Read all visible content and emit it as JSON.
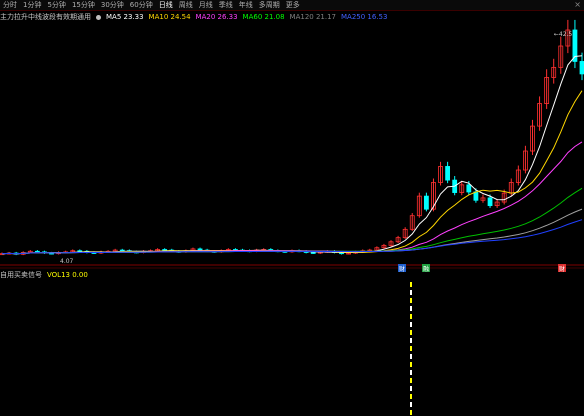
{
  "toolbar": {
    "tabs": [
      "分时",
      "1分钟",
      "5分钟",
      "15分钟",
      "30分钟",
      "60分钟",
      "日线",
      "周线",
      "月线",
      "季线",
      "年线",
      "多周期",
      "更多"
    ],
    "active": 6,
    "close_glyph": "×"
  },
  "main_indicator": {
    "formula_name": "主力拉升中线波段有效期通用",
    "items": [
      {
        "label": "MA5",
        "value": "23.33",
        "color": "#ffffff"
      },
      {
        "label": "MA10",
        "value": "24.54",
        "color": "#ffd700"
      },
      {
        "label": "MA20",
        "value": "26.33",
        "color": "#ff40ff"
      },
      {
        "label": "MA60",
        "value": "21.08",
        "color": "#00ff00"
      },
      {
        "label": "MA120",
        "value": "21.17",
        "color": "#808080"
      },
      {
        "label": "MA250",
        "value": "16.53",
        "color": "#4060ff"
      }
    ]
  },
  "price_labels": {
    "high": "42.5",
    "low": "4.07"
  },
  "markers": [
    {
      "text": "财",
      "color": "#2060d0"
    },
    {
      "text": "融",
      "color": "#20a040"
    },
    {
      "text": "财",
      "color": "#e03030"
    }
  ],
  "sub_indicator": {
    "name": "自用买卖信号",
    "items": [
      {
        "label": "VOL13",
        "value": "0.00",
        "color": "#ffff00"
      }
    ]
  },
  "colors": {
    "up": "#ff3030",
    "down": "#00ffff",
    "ma5": "#ffffff",
    "ma10": "#ffd700",
    "ma20": "#ff40ff",
    "ma60": "#00c000",
    "ma120": "#a0a0a0",
    "ma250": "#2040ff",
    "divider": "#800000"
  },
  "chart_data": {
    "type": "candlestick",
    "note_series": [
      "price"
    ],
    "close": [
      4.8,
      4.9,
      4.7,
      5.0,
      5.2,
      5.1,
      4.9,
      4.8,
      5.0,
      5.1,
      5.3,
      5.2,
      5.0,
      4.9,
      5.1,
      5.2,
      5.4,
      5.3,
      5.1,
      5.0,
      5.2,
      5.3,
      5.5,
      5.4,
      5.2,
      5.1,
      5.3,
      5.6,
      5.4,
      5.2,
      5.1,
      5.3,
      5.5,
      5.4,
      5.3,
      5.2,
      5.4,
      5.5,
      5.3,
      5.2,
      5.1,
      5.3,
      5.2,
      5.0,
      4.9,
      5.1,
      5.2,
      5.0,
      4.8,
      4.9,
      5.1,
      5.3,
      5.4,
      5.8,
      6.2,
      6.8,
      7.5,
      8.9,
      11.2,
      14.5,
      12.3,
      16.8,
      19.5,
      17.2,
      15.1,
      16.4,
      15.2,
      13.8,
      14.2,
      12.9,
      13.5,
      15.0,
      16.8,
      18.9,
      22.1,
      26.3,
      30.1,
      34.5,
      36.2,
      39.8,
      42.5,
      37.2,
      35.1
    ]
  }
}
